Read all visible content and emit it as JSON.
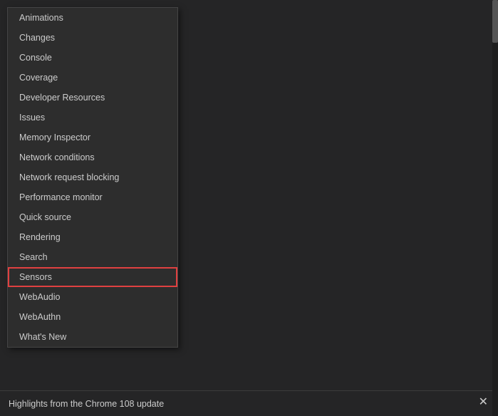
{
  "menu": {
    "items": [
      {
        "label": "Animations",
        "highlighted": false
      },
      {
        "label": "Changes",
        "highlighted": false
      },
      {
        "label": "Console",
        "highlighted": false
      },
      {
        "label": "Coverage",
        "highlighted": false
      },
      {
        "label": "Developer Resources",
        "highlighted": false
      },
      {
        "label": "Issues",
        "highlighted": false
      },
      {
        "label": "Memory Inspector",
        "highlighted": false
      },
      {
        "label": "Network conditions",
        "highlighted": false
      },
      {
        "label": "Network request blocking",
        "highlighted": false
      },
      {
        "label": "Performance monitor",
        "highlighted": false
      },
      {
        "label": "Quick source",
        "highlighted": false
      },
      {
        "label": "Rendering",
        "highlighted": false
      },
      {
        "label": "Search",
        "highlighted": false
      },
      {
        "label": "Sensors",
        "highlighted": true
      },
      {
        "label": "WebAudio",
        "highlighted": false
      },
      {
        "label": "WebAuthn",
        "highlighted": false
      },
      {
        "label": "What's New",
        "highlighted": false
      }
    ]
  },
  "bottom_bar": {
    "text": "Highlights from the Chrome 108 update"
  },
  "close": "✕"
}
